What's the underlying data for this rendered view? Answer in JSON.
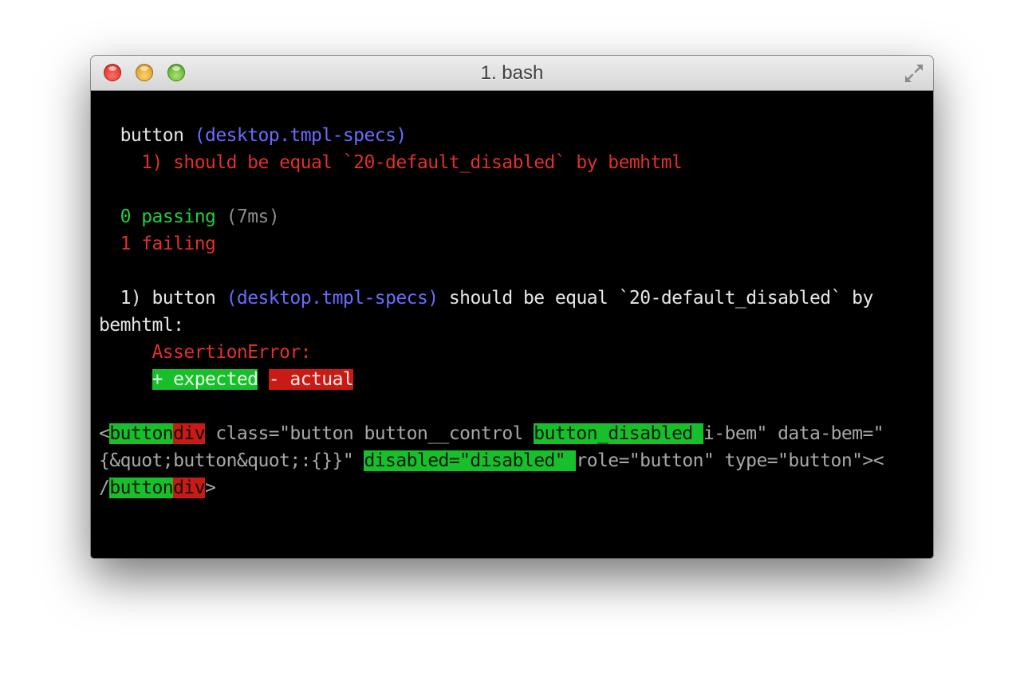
{
  "window": {
    "title": "1. bash"
  },
  "terminal": {
    "suite": {
      "name": "button",
      "spec_path": "(desktop.tmpl-specs)",
      "failure_item": "1) should be equal `20-default_disabled` by bemhtml"
    },
    "summary": {
      "passing_count": "0",
      "passing_label": "passing",
      "passing_time": "(7ms)",
      "failing_count": "1",
      "failing_label": "failing"
    },
    "detail": {
      "prefix": "1) button",
      "spec_path": "(desktop.tmpl-specs)",
      "message": "should be equal `20-default_disabled` by",
      "message_cont": "bemhtml:",
      "error_type": "AssertionError:",
      "legend_expected": "+ expected",
      "legend_actual": "- actual"
    },
    "diff": {
      "l1_lt": "<",
      "l1_exp_tag": "button",
      "l1_act_tag": "div",
      "l1_mid": " class=\"button button__control ",
      "l1_exp_class": "button_disabled ",
      "l1_tail": "i-bem\" data-bem=\"",
      "l2_head": "{&quot;button&quot;:{}}\" ",
      "l2_exp_attr": "disabled=\"disabled\" ",
      "l2_tail": "role=\"button\" type=\"button\"><",
      "l3_slash": "/",
      "l3_exp_tag": "button",
      "l3_act_tag": "div",
      "l3_gt": ">"
    }
  },
  "colors": {
    "terminal_bg": "#000000",
    "text": "#e6e6e6",
    "blue": "#6b6bff",
    "red": "#e03128",
    "green": "#1fcf3a",
    "diff_added_bg": "#17c02b",
    "diff_removed_bg": "#c81b15"
  }
}
